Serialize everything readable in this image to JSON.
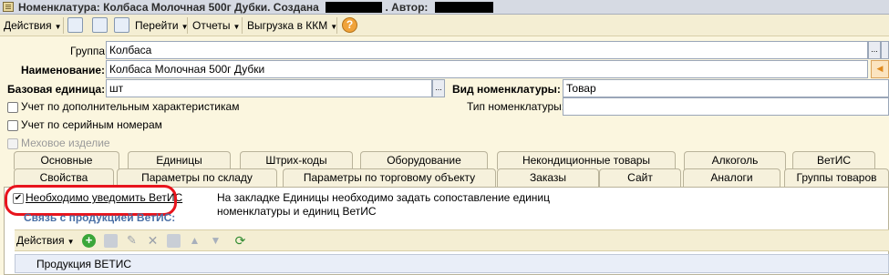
{
  "window": {
    "title_prefix": "Номенклатура: Колбаса Молочная 500г Дубки. Создана",
    "title_author": ". Автор:"
  },
  "toolbar": {
    "actions": "Действия",
    "goto": "Перейти",
    "reports": "Отчеты",
    "export_kkm": "Выгрузка в ККМ",
    "help": "?"
  },
  "form": {
    "group_label": "Группа:",
    "group_value": "Колбаса",
    "name_label": "Наименование:",
    "name_value": "Колбаса Молочная 500г Дубки",
    "base_unit_label": "Базовая единица:",
    "base_unit_value": "шт",
    "kind_label": "Вид номенклатуры:",
    "kind_value": "Товар",
    "type_label": "Тип номенклатуры:",
    "type_value": "",
    "ellipsis": "...",
    "chk_characteristics": "Учет по дополнительным характеристикам",
    "chk_serials": "Учет по серийным номерам",
    "chk_fur": "Меховое изделие"
  },
  "tabs_row1": [
    "Основные",
    "Единицы",
    "Штрих-коды",
    "Оборудование",
    "Некондиционные товары",
    "Алкоголь",
    "ВетИС"
  ],
  "tabs_row2": [
    "Свойства",
    "Параметры по складу",
    "Параметры по торговому объекту",
    "Заказы",
    "Сайт",
    "Аналоги",
    "Группы товаров"
  ],
  "vetis": {
    "notify_label": "Необходимо уведомить ВетИС",
    "notify_checked": true,
    "info_line1": "На закладке Единицы необходимо задать сопоставление единиц",
    "info_line2": "номенклатуры и единиц ВетИС",
    "section_title": "Связь с продукцией ВетИС:",
    "inner_actions": "Действия",
    "column_product": "Продукция ВЕТИС"
  },
  "icons": {
    "toolbar": [
      "post-icon",
      "refresh-icon",
      "copy-icon",
      "help-icon"
    ],
    "inner_toolbar": [
      "add-icon",
      "copy-icon",
      "edit-icon",
      "delete-icon",
      "save-icon",
      "move-up-icon",
      "move-down-icon",
      "refresh-icon"
    ]
  },
  "colors": {
    "background": "#fbf6df",
    "highlight": "#e8141d",
    "section_title": "#4a6fa5"
  }
}
